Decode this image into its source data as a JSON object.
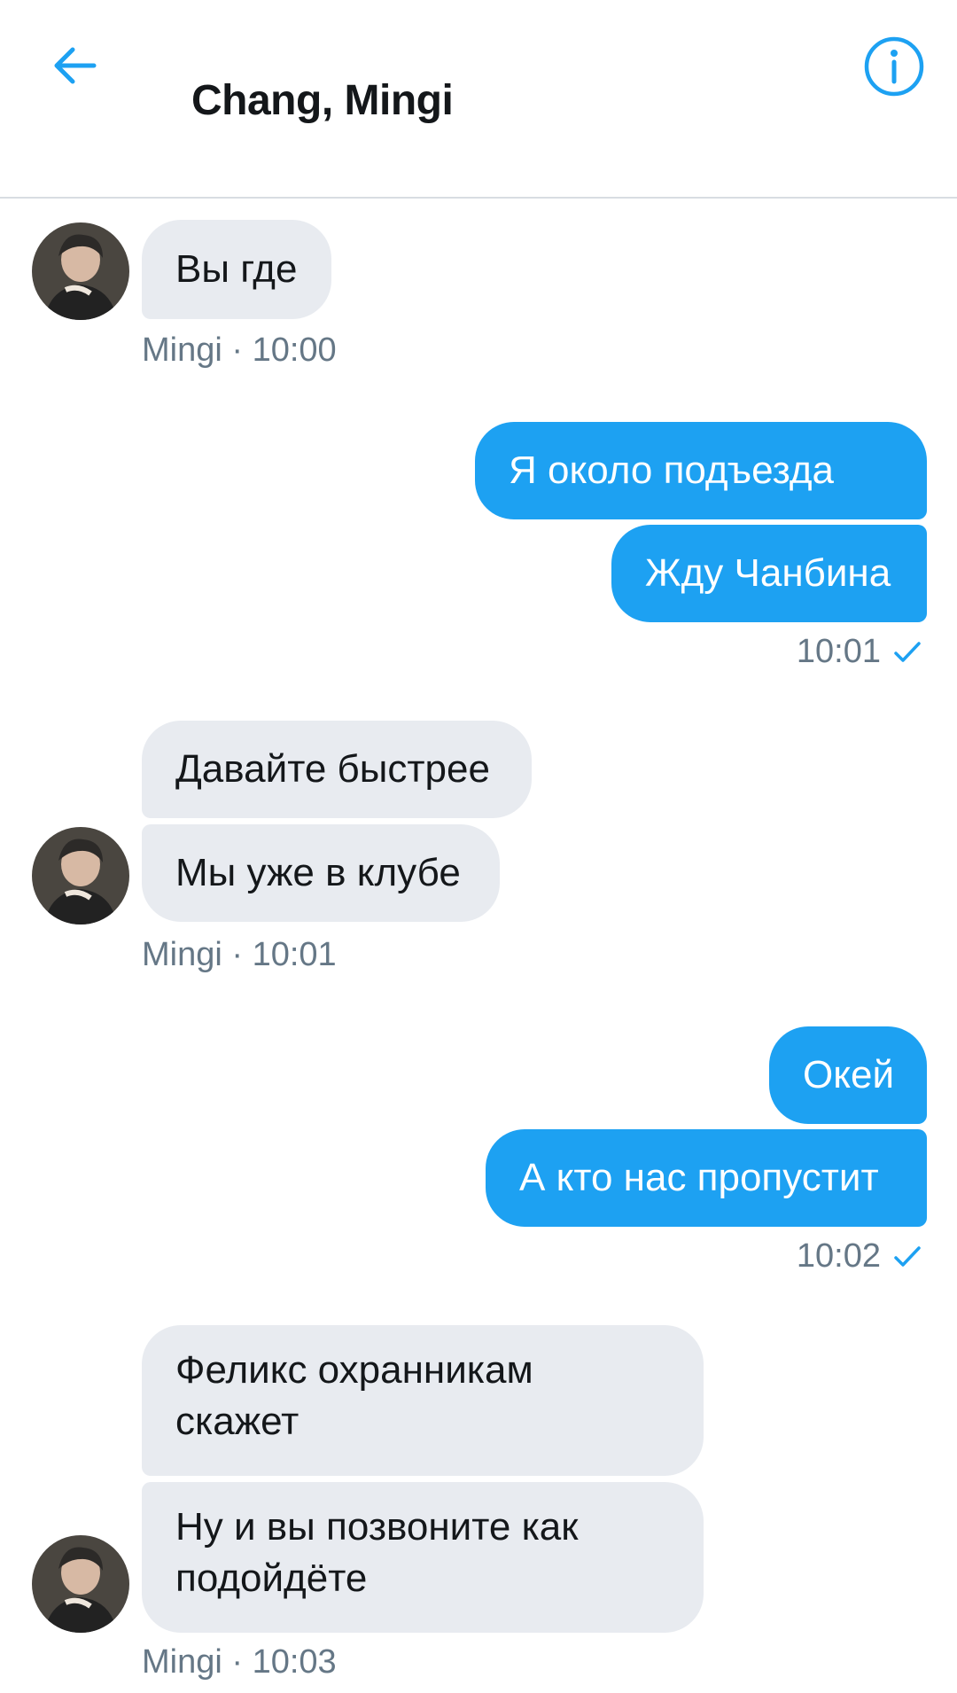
{
  "header": {
    "title": "Chang, Mingi",
    "back_icon": "arrow-left-icon",
    "info_icon": "info-circle-icon",
    "accent_color": "#1da1f2"
  },
  "messages": [
    {
      "side": "in",
      "text": "Вы где"
    },
    {
      "side": "in",
      "meta": "Mingi · 10:00"
    },
    {
      "side": "out",
      "text": "Я около подъезда"
    },
    {
      "side": "out",
      "text": "Жду Чанбина"
    },
    {
      "side": "out",
      "meta": "10:01"
    },
    {
      "side": "in",
      "text": "Давайте быстрее"
    },
    {
      "side": "in",
      "text": "Мы уже в клубе"
    },
    {
      "side": "in",
      "meta": "Mingi · 10:01"
    },
    {
      "side": "out",
      "text": "Окей"
    },
    {
      "side": "out",
      "text": "А кто нас пропустит"
    },
    {
      "side": "out",
      "meta": "10:02"
    },
    {
      "side": "in",
      "text_line1": "Феликс охранникам",
      "text_line2": "скажет"
    },
    {
      "side": "in",
      "text_line1": "Ну и вы позвоните как",
      "text_line2": "подойдёте"
    },
    {
      "side": "in",
      "meta": "Mingi · 10:03"
    }
  ],
  "status_icon": "check-icon",
  "colors": {
    "incoming_bubble": "#e8ebf0",
    "outgoing_bubble": "#1da1f2",
    "meta_text": "#657786"
  }
}
